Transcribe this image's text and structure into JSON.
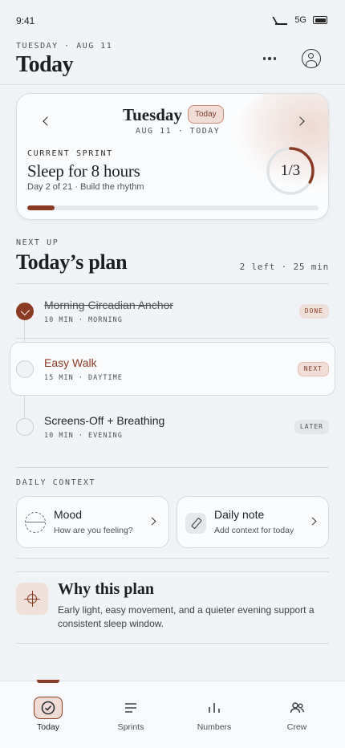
{
  "status": {
    "time": "9:41",
    "network": "5G"
  },
  "header": {
    "date": "TUESDAY · AUG 11",
    "title": "Today"
  },
  "sprint_card": {
    "day": "Tuesday",
    "today_pill": "Today",
    "subdate": "AUG 11 · TODAY",
    "label": "CURRENT SPRINT",
    "goal": "Sleep for 8 hours",
    "sub": "Day 2 of 21 · Build the rhythm",
    "ring_text": "1/3",
    "ring_progress": 0.333,
    "sprint_progress": 0.095,
    "accent": "#8b3b24"
  },
  "plan": {
    "eyebrow": "NEXT UP",
    "title": "Today’s plan",
    "meta": "2 left · 25 min",
    "tasks": [
      {
        "name": "Morning Circadian Anchor",
        "meta": "10 MIN · MORNING",
        "tag": "DONE",
        "state": "done"
      },
      {
        "name": "Easy Walk",
        "meta": "15 MIN · DAYTIME",
        "tag": "NEXT",
        "state": "next"
      },
      {
        "name": "Screens-Off + Breathing",
        "meta": "10 MIN · EVENING",
        "tag": "LATER",
        "state": "later"
      }
    ]
  },
  "context": {
    "eyebrow": "DAILY CONTEXT",
    "mood": {
      "label": "Mood",
      "sub": "How are you feeling?",
      "icon": "mood-icon"
    },
    "note": {
      "label": "Daily note",
      "sub": "Add context for today",
      "icon": "pencil-icon"
    }
  },
  "why": {
    "title": "Why this plan",
    "body": "Early light, easy movement, and a quieter evening support a consistent sleep window.",
    "icon": "crosshair-icon"
  },
  "tabs": [
    {
      "label": "Today",
      "icon": "check-circle-icon",
      "active": true
    },
    {
      "label": "Sprints",
      "icon": "list-icon",
      "active": false
    },
    {
      "label": "Numbers",
      "icon": "bar-chart-icon",
      "active": false
    },
    {
      "label": "Crew",
      "icon": "people-icon",
      "active": false
    }
  ]
}
